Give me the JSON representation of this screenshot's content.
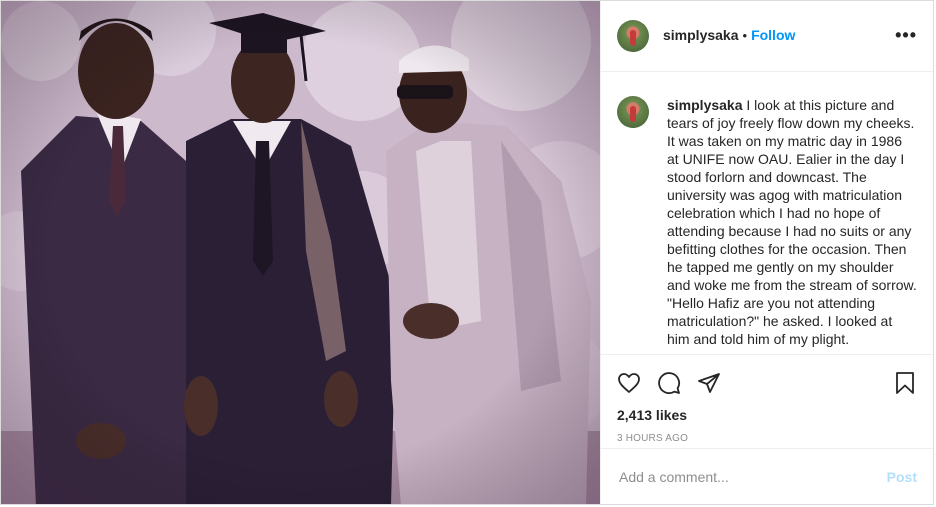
{
  "post": {
    "username": "simplysaka",
    "follow_label": "Follow",
    "separator": "•",
    "more_label": "•••",
    "caption_user": "simplysaka",
    "caption_text": " I look at this picture and tears of joy freely flow down my cheeks. It was taken on my matric day in 1986 at UNIFE now OAU. Ealier in the day I stood forlorn and downcast. The university was agog with matriculation celebration which I had no hope of attending because I had no suits or any befitting clothes for the occasion. Then he tapped me gently on my shoulder and woke me from the stream of sorrow. \"Hello Hafiz are you not attending matriculation?\" he asked. I looked at him and told him of my plight.",
    "likes": "2,413 likes",
    "time": "3 HOURS AGO",
    "comment_placeholder": "Add a comment...",
    "post_button": "Post"
  },
  "icons": {
    "like": "heart-icon",
    "comment": "comment-icon",
    "share": "share-icon",
    "save": "bookmark-icon"
  },
  "colors": {
    "link": "#0095f6",
    "post_disabled": "#b2dffc",
    "meta": "#8e8e8e"
  }
}
